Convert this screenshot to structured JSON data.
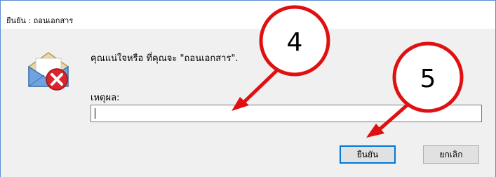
{
  "window": {
    "title": "ยืนยัน : ถอนเอกสาร"
  },
  "dialog": {
    "icon": "mail-error-icon",
    "message": "คุณแน่ใจหรือ ที่คุณจะ \"ถอนเอกสาร\".",
    "reason_label": "เหตุผล:",
    "reason_value": "",
    "reason_placeholder": ""
  },
  "buttons": {
    "confirm_label": "ยืนยัน",
    "cancel_label": "ยกเลิก"
  },
  "annotations": {
    "callout_1": "4",
    "callout_2": "5",
    "accent_color": "#e01010"
  }
}
